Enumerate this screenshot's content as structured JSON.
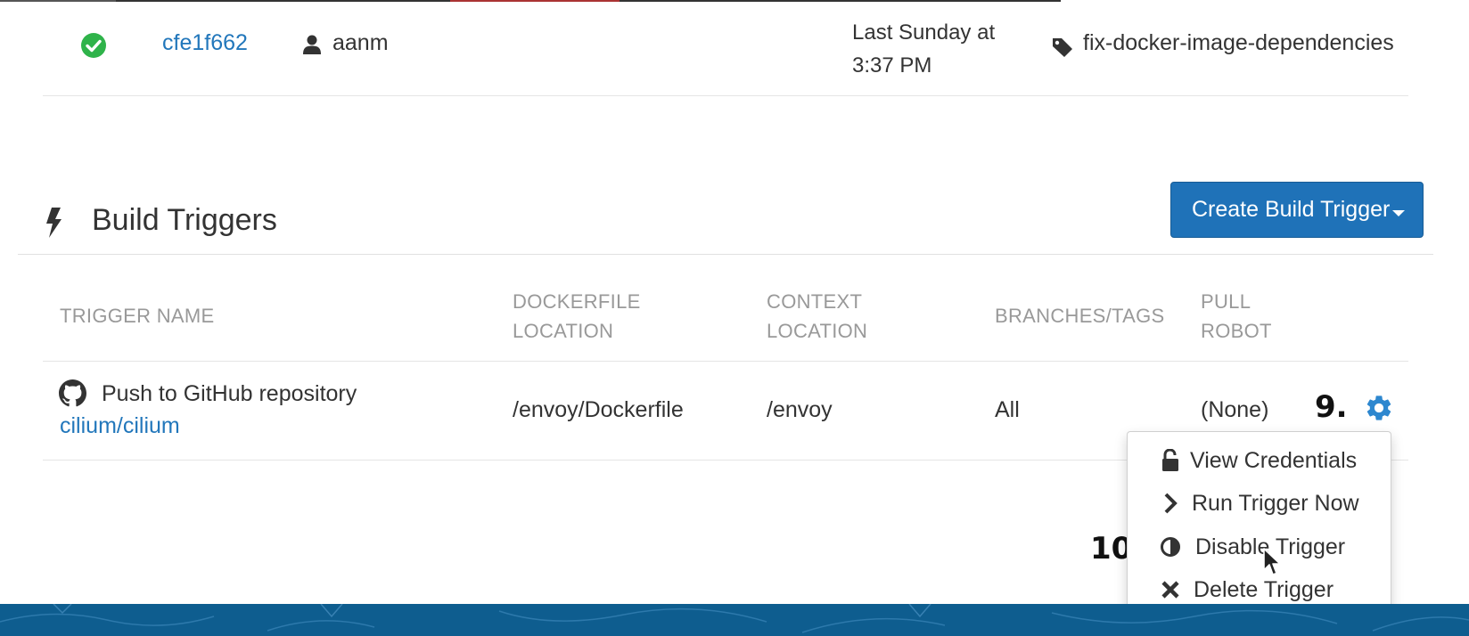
{
  "build": {
    "id": "cfe1f662",
    "user": "aanm",
    "date_line1": "Last Sunday at",
    "date_line2": "3:37 PM",
    "tag": "fix-docker-image-dependencies",
    "status_color": "#2fb34a",
    "link_color": "#2277bb"
  },
  "section": {
    "title": "Build Triggers",
    "create_button": "Create Build Trigger",
    "button_color": "#1f72b8"
  },
  "table": {
    "headers": {
      "name": "TRIGGER NAME",
      "docker_l1": "DOCKERFILE",
      "docker_l2": "LOCATION",
      "context_l1": "CONTEXT",
      "context_l2": "LOCATION",
      "branches": "BRANCHES/TAGS",
      "robot_l1": "PULL",
      "robot_l2": "ROBOT"
    },
    "rows": [
      {
        "description": "Push to GitHub repository",
        "repo": "cilium/cilium",
        "dockerfile": "/envoy/Dockerfile",
        "context": "/envoy",
        "branches": "All",
        "robot": "(None)"
      }
    ]
  },
  "annotations": {
    "step9": "9.",
    "step10": "10."
  },
  "menu": {
    "items": [
      {
        "label": "View Credentials",
        "icon": "unlock-icon"
      },
      {
        "label": "Run Trigger Now",
        "icon": "chevron-right-icon"
      },
      {
        "label": "Disable Trigger",
        "icon": "adjust-icon"
      },
      {
        "label": "Delete Trigger",
        "icon": "close-icon"
      }
    ]
  },
  "footer": {
    "color": "#0e5d8f"
  }
}
